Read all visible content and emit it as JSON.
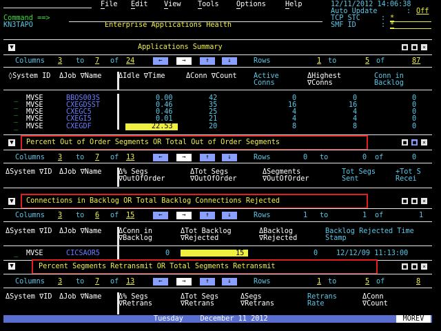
{
  "menu": {
    "items": [
      "File",
      "Edit",
      "View",
      "Tools",
      "Options",
      "Help"
    ]
  },
  "header": {
    "datetime": "12/11/2012 14:06:38",
    "auto_update_label": "Auto Update",
    "auto_update_value": "Off",
    "tcp_stc_label": "TCP STC",
    "tcp_stc_value": "*",
    "smf_id_label": "SMF ID",
    "smf_id_value": "*",
    "command_label": "Command ==>",
    "system_id": "KN3TAPO",
    "title": "Enterprise Applications Health"
  },
  "sections": [
    {
      "title": "Applications Summary",
      "columns_label": "Columns",
      "col_from": "3",
      "col_to": "7",
      "col_of": "24",
      "rows_label": "Rows",
      "row_from": "1",
      "row_to": "5",
      "row_of": "87",
      "headers": [
        "◊System ID",
        "ΔJob ∇Name",
        "ΔIdle ∇Time",
        "ΔConn ∇Count",
        "Active Conns",
        "ΔHighest ∇Conns",
        "Conn in Backlog"
      ],
      "rows": [
        [
          "MVSE",
          "BBOS003S",
          "0.00",
          "42",
          "0",
          "0",
          "0"
        ],
        [
          "MVSE",
          "CXEGDSST",
          "0.46",
          "35",
          "16",
          "16",
          "0"
        ],
        [
          "MVSE",
          "CXEGC5",
          "0.46",
          "25",
          "4",
          "4",
          "0"
        ],
        [
          "MVSE",
          "CXEGI5",
          "0.01",
          "21",
          "4",
          "4",
          "0"
        ],
        [
          "MVSE",
          "CXEGDF",
          "22.53",
          "20",
          "8",
          "8",
          "0"
        ]
      ]
    },
    {
      "title": "Percent Out of Order Segments OR Total Out of Order Segments",
      "columns_label": "Columns",
      "col_from": "3",
      "col_to": "7",
      "col_of": "13",
      "rows_label": "Rows",
      "row_from": "0",
      "row_to": "to",
      "row_of": "0",
      "headers": [
        "ΔSystem ∇ID",
        "ΔJob ∇Name",
        "Δ% Segs ∇OutOfOrder",
        "ΔTot Segs ∇OutOfOrder",
        "ΔSegments ∇OutOfOrder",
        "Tot Segs Sent",
        "+Tot S Recei"
      ]
    },
    {
      "title": "Connections in Backlog OR Total Backlog Connections Rejected",
      "columns_label": "Columns",
      "col_from": "3",
      "col_to": "6",
      "col_of": "15",
      "rows_label": "Rows",
      "row_from": "1",
      "row_to": "to",
      "row_of": "1",
      "headers": [
        "ΔSystem ∇ID",
        "ΔJob ∇Name",
        "ΔConn in ∇Backlog",
        "ΔTot Backlog ∇Rejected",
        "ΔBacklog ∇Rejected",
        "Backlog Rejected Time Stamp"
      ],
      "rows": [
        [
          "MVSE",
          "CICSAOR5",
          "0",
          "15",
          "0",
          "12/12/09 11:13:00"
        ]
      ]
    },
    {
      "title": "Percent Segments Retransmit OR Total Segments Retransmit",
      "columns_label": "Columns",
      "col_from": "3",
      "col_to": "7",
      "col_of": "13",
      "rows_label": "Rows",
      "row_from": "1",
      "row_to": "5",
      "row_of": "8",
      "headers": [
        "ΔSystem ∇ID",
        "ΔJob ∇Name",
        "Δ% Segs ∇Retrans",
        "ΔTot Segs ∇Retrans",
        "ΔSegs ∇Retrans",
        "Retrans Rate",
        "ΔConn ∇Count"
      ]
    }
  ],
  "status": {
    "date_text": "Tuesday    December 11 2012",
    "more_label": "MOREV"
  },
  "words": {
    "to": "to",
    "of": "of"
  }
}
